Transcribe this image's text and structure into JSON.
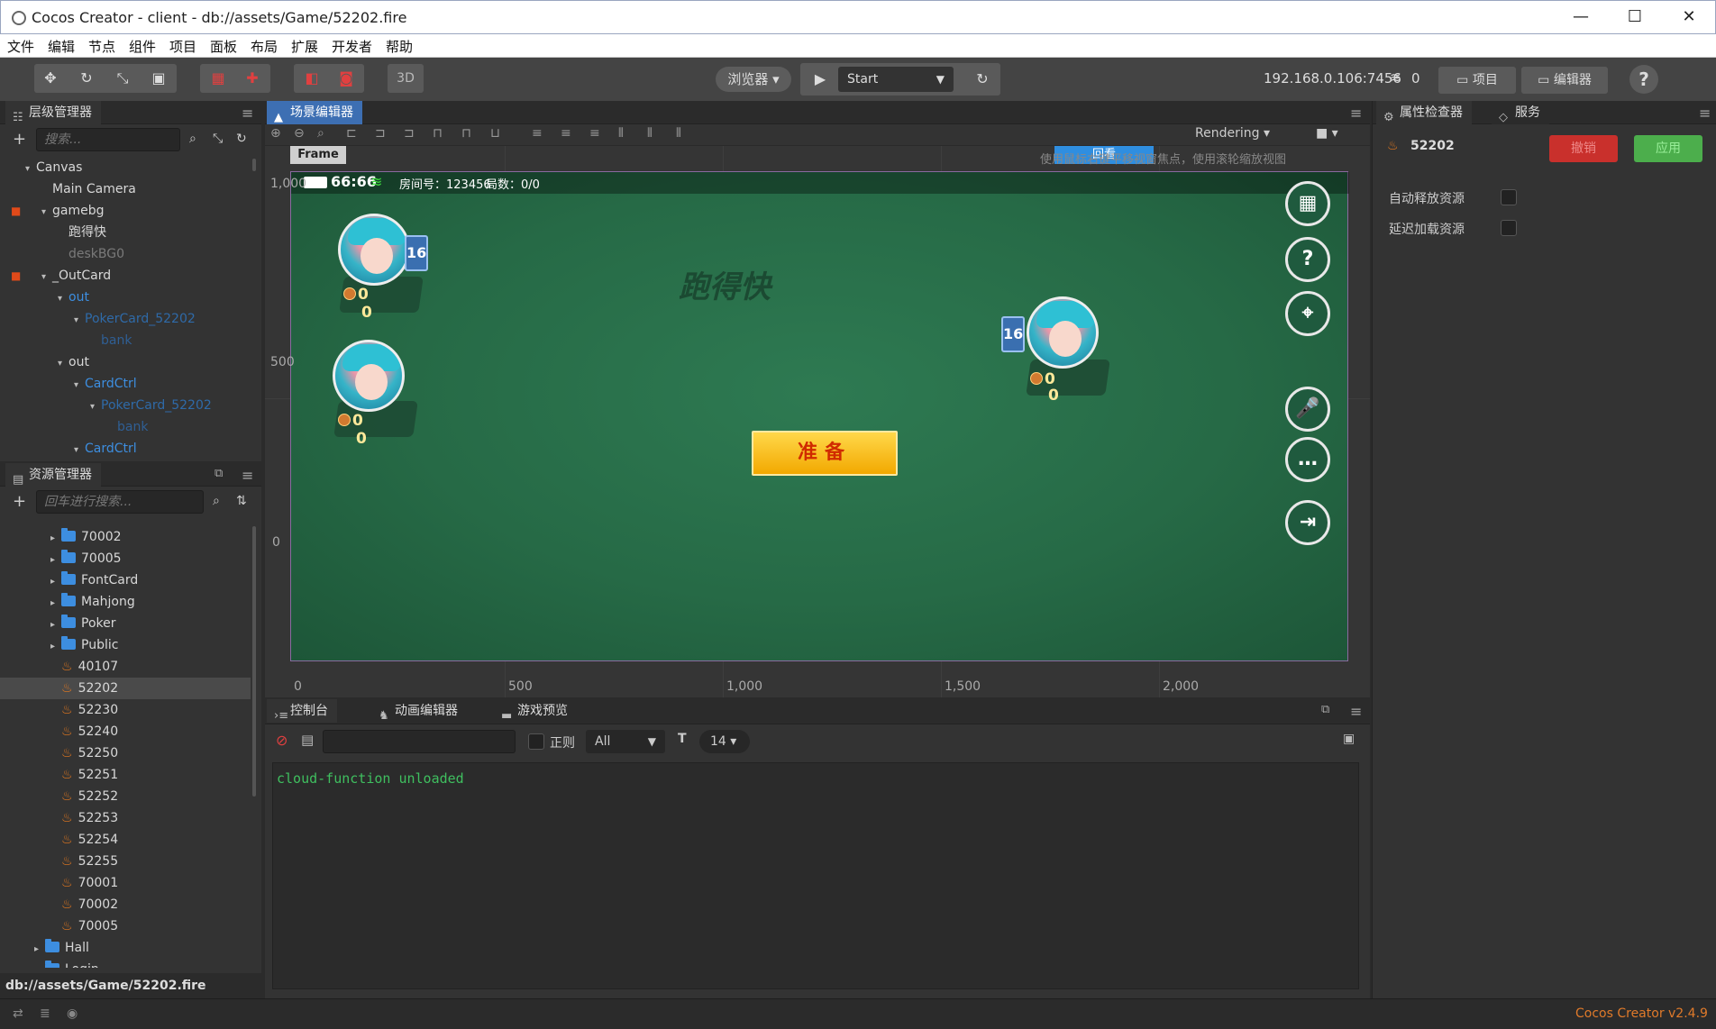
{
  "window": {
    "title": "Cocos Creator - client - db://assets/Game/52202.fire"
  },
  "menu": [
    "文件",
    "编辑",
    "节点",
    "组件",
    "项目",
    "面板",
    "布局",
    "扩展",
    "开发者",
    "帮助"
  ],
  "toolbar": {
    "tool_icons": [
      "move-tool-icon",
      "rotate-tool-icon",
      "scale-tool-icon",
      "rect-tool-icon"
    ],
    "mode_3d": "3D",
    "browser_label": "浏览器 ▾",
    "scene_select": "Start",
    "ip": "192.168.0.106:7456",
    "connections": "0",
    "project_btn": "项目",
    "editor_btn": "编辑器",
    "help": "?"
  },
  "hierarchy": {
    "title": "层级管理器",
    "search_placeholder": "搜索...",
    "nodes": [
      {
        "label": "Canvas",
        "depth": 0,
        "arrow": "▾",
        "color": "#d8d8d8",
        "lock": false
      },
      {
        "label": "Main Camera",
        "depth": 1,
        "arrow": "",
        "color": "#d8d8d8",
        "lock": false
      },
      {
        "label": "gamebg",
        "depth": 1,
        "arrow": "▾",
        "color": "#d8d8d8",
        "lock": true
      },
      {
        "label": "跑得快",
        "depth": 2,
        "arrow": "",
        "color": "#d8d8d8",
        "lock": false
      },
      {
        "label": "deskBG0",
        "depth": 2,
        "arrow": "",
        "color": "#7a7a7a",
        "lock": false
      },
      {
        "label": "_OutCard",
        "depth": 1,
        "arrow": "▾",
        "color": "#d8d8d8",
        "lock": true
      },
      {
        "label": "out",
        "depth": 2,
        "arrow": "▾",
        "color": "#3d8ee0",
        "lock": false
      },
      {
        "label": "PokerCard_52202",
        "depth": 3,
        "arrow": "▾",
        "color": "#2f6aa8",
        "lock": false
      },
      {
        "label": "bank",
        "depth": 4,
        "arrow": "",
        "color": "#2f5f95",
        "lock": false
      },
      {
        "label": "out",
        "depth": 2,
        "arrow": "▾",
        "color": "#d8d8d8",
        "lock": false
      },
      {
        "label": "CardCtrl",
        "depth": 3,
        "arrow": "▾",
        "color": "#3d8ee0",
        "lock": false
      },
      {
        "label": "PokerCard_52202",
        "depth": 4,
        "arrow": "▾",
        "color": "#2f6aa8",
        "lock": false
      },
      {
        "label": "bank",
        "depth": 5,
        "arrow": "",
        "color": "#2f5f95",
        "lock": false
      },
      {
        "label": "CardCtrl",
        "depth": 3,
        "arrow": "▾",
        "color": "#3d8ee0",
        "lock": false
      }
    ]
  },
  "assets": {
    "title": "资源管理器",
    "search_placeholder": "回车进行搜索...",
    "items": [
      {
        "label": "70002",
        "type": "folder",
        "depth": 1
      },
      {
        "label": "70005",
        "type": "folder",
        "depth": 1
      },
      {
        "label": "FontCard",
        "type": "folder",
        "depth": 1
      },
      {
        "label": "Mahjong",
        "type": "folder",
        "depth": 1
      },
      {
        "label": "Poker",
        "type": "folder",
        "depth": 1
      },
      {
        "label": "Public",
        "type": "folder",
        "depth": 1
      },
      {
        "label": "40107",
        "type": "scene",
        "depth": 1
      },
      {
        "label": "52202",
        "type": "scene",
        "depth": 1,
        "selected": true
      },
      {
        "label": "52230",
        "type": "scene",
        "depth": 1
      },
      {
        "label": "52240",
        "type": "scene",
        "depth": 1
      },
      {
        "label": "52250",
        "type": "scene",
        "depth": 1
      },
      {
        "label": "52251",
        "type": "scene",
        "depth": 1
      },
      {
        "label": "52252",
        "type": "scene",
        "depth": 1
      },
      {
        "label": "52253",
        "type": "scene",
        "depth": 1
      },
      {
        "label": "52254",
        "type": "scene",
        "depth": 1
      },
      {
        "label": "52255",
        "type": "scene",
        "depth": 1
      },
      {
        "label": "70001",
        "type": "scene",
        "depth": 1
      },
      {
        "label": "70002",
        "type": "scene",
        "depth": 1
      },
      {
        "label": "70005",
        "type": "scene",
        "depth": 1
      },
      {
        "label": "Hall",
        "type": "folder",
        "depth": 0
      },
      {
        "label": "Login",
        "type": "folder",
        "depth": 0
      }
    ],
    "path": "db://assets/Game/52202.fire"
  },
  "scene": {
    "title": "场景编辑器",
    "rendering": "Rendering",
    "frame_label": "Frame",
    "hint": "使用鼠标右键平移视窗焦点，使用滚轮缩放视图",
    "back_btn": "回看",
    "x_ruler": [
      "0",
      "500",
      "1,000",
      "1,500",
      "2,000"
    ],
    "y_ruler": [
      "1,000",
      "500",
      "0"
    ],
    "hud": {
      "time": "66:66",
      "room": "房间号：123456",
      "rounds": "局数：0/0"
    },
    "watermark": "跑得快",
    "ready_label": "准备",
    "card_count": "16",
    "scores": [
      "0",
      "0"
    ]
  },
  "inspector": {
    "tab_inspector": "属性检查器",
    "tab_service": "服务",
    "asset_name": "52202",
    "revert_btn": "撤销",
    "apply_btn": "应用",
    "revert_color": "#c9302c",
    "apply_color": "#4cae4c",
    "props": [
      "自动释放资源",
      "延迟加载资源"
    ]
  },
  "console": {
    "tab_console": "控制台",
    "tab_animation": "动画编辑器",
    "tab_preview": "游戏预览",
    "regex_label": "正则",
    "level_select": "All",
    "font_size": "14",
    "log": "cloud-function unloaded"
  },
  "status": {
    "version": "Cocos Creator v2.4.9"
  }
}
